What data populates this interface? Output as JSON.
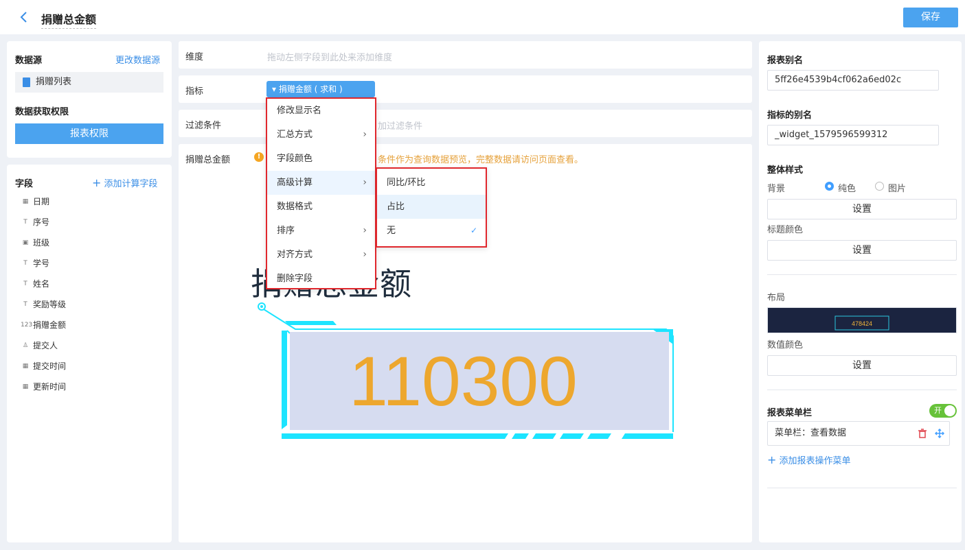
{
  "header": {
    "title": "捐赠总金额",
    "save_label": "保存"
  },
  "left": {
    "datasource_title": "数据源",
    "change_datasource": "更改数据源",
    "datasource_item": "捐赠列表",
    "permission_title": "数据获取权限",
    "permission_button": "报表权限",
    "fields_title": "字段",
    "add_calc_field": "添加计算字段",
    "fields": [
      {
        "icon": "date-icon",
        "icon_glyph": "▦",
        "label": "日期"
      },
      {
        "icon": "text-icon",
        "icon_glyph": "T",
        "label": "序号"
      },
      {
        "icon": "select-icon",
        "icon_glyph": "▣",
        "label": "班级"
      },
      {
        "icon": "text-icon",
        "icon_glyph": "T",
        "label": "学号"
      },
      {
        "icon": "text-icon",
        "icon_glyph": "T",
        "label": "姓名"
      },
      {
        "icon": "text-icon",
        "icon_glyph": "T",
        "label": "奖励等级"
      },
      {
        "icon": "number-icon",
        "icon_glyph": "123",
        "label": "捐赠金额"
      },
      {
        "icon": "user-icon",
        "icon_glyph": "♙",
        "label": "提交人"
      },
      {
        "icon": "date-icon",
        "icon_glyph": "▦",
        "label": "提交时间"
      },
      {
        "icon": "date-icon",
        "icon_glyph": "▦",
        "label": "更新时间"
      }
    ]
  },
  "middle": {
    "dimension_label": "维度",
    "dimension_placeholder": "拖动左侧字段到此处来添加维度",
    "metric_label": "指标",
    "metric_tag": "▾ 捐赠金额 ( 求和 )",
    "filter_label": "过滤条件",
    "filter_placeholder": "加过滤条件",
    "preview_label": "捐赠总金额",
    "warning_text": "条件作为查询数据预览，完整数据请访问页面查看。",
    "chart_title": "捐赠总金额",
    "chart_value": "110300"
  },
  "dropdown": {
    "items": [
      {
        "label": "修改显示名",
        "arrow": ""
      },
      {
        "label": "汇总方式",
        "arrow": "›"
      },
      {
        "label": "字段颜色",
        "arrow": ""
      },
      {
        "label": "高级计算",
        "arrow": "›"
      },
      {
        "label": "数据格式",
        "arrow": ""
      },
      {
        "label": "排序",
        "arrow": "›"
      },
      {
        "label": "对齐方式",
        "arrow": "›"
      },
      {
        "label": "删除字段",
        "arrow": ""
      }
    ],
    "submenu": [
      {
        "label": "同比/环比",
        "check": ""
      },
      {
        "label": "占比",
        "check": ""
      },
      {
        "label": "无",
        "check": "✓"
      }
    ]
  },
  "right": {
    "alias_title": "报表别名",
    "alias_value": "5ff26e4539b4cf062a6ed02c",
    "metric_alias_title": "指标的别名",
    "metric_alias_value": "_widget_1579596599312",
    "style_title": "整体样式",
    "bg_label": "背景",
    "bg_solid": "纯色",
    "bg_image": "图片",
    "set_label": "设置",
    "title_color_label": "标题颜色",
    "layout_label": "布局",
    "layout_preview_value": "478424",
    "value_color_label": "数值颜色",
    "menu_bar_title": "报表菜单栏",
    "toggle_label": "开",
    "menu_bar_item": "菜单栏：查看数据",
    "add_menu": "添加报表操作菜单"
  },
  "colors": {
    "accent": "#4ba3ef",
    "value": "#eda72e",
    "highlight_border": "#e0262c",
    "frame_cyan": "#1de4ff"
  }
}
